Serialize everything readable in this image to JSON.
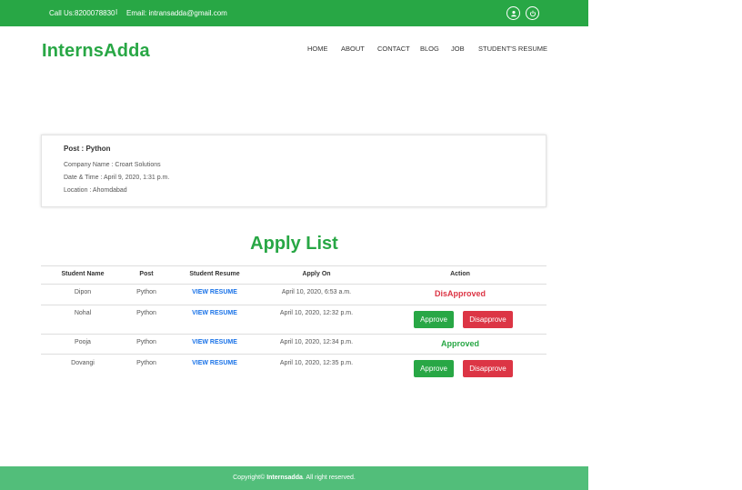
{
  "topbar": {
    "contact": "Call Us:8200078830",
    "separator": "I",
    "email": "Email: intransadda@gmail.com",
    "icons": [
      "user-icon",
      "power-icon"
    ]
  },
  "brand": {
    "name": "InternsAdda"
  },
  "nav": [
    "HOME",
    "ABOUT",
    "CONTACT",
    "BLOG",
    "JOB",
    "STUDENT'S RESUME"
  ],
  "post": {
    "title": "Post : Python",
    "company": "Company Name : Croart Solutions",
    "datetime": "Date & Time : April 9, 2020, 1:31 p.m.",
    "location": "Location : Ahomdabad"
  },
  "apply_list": {
    "title": "Apply List",
    "headers": [
      "Student Name",
      "Post",
      "Student Resume",
      "Apply On",
      "Action"
    ],
    "rows": [
      {
        "name": "Dipon",
        "post": "Python",
        "resume": "VIEW RESUME",
        "applied_on": "April 10, 2020, 6:53 a.m.",
        "status": "DisApproved"
      },
      {
        "name": "Nohal",
        "post": "Python",
        "resume": "VIEW RESUME",
        "applied_on": "April 10, 2020, 12:32 p.m.",
        "approve": "Approve",
        "disapprove": "Disapprove"
      },
      {
        "name": "Pooja",
        "post": "Python",
        "resume": "VIEW RESUME",
        "applied_on": "April 10, 2020, 12:34 p.m.",
        "status": "Approved"
      },
      {
        "name": "Dovangi",
        "post": "Python",
        "resume": "VIEW RESUME",
        "applied_on": "April 10, 2020, 12:35 p.m.",
        "approve": "Approve",
        "disapprove": "Disapprove"
      }
    ]
  },
  "footer": {
    "prefix": "Copyright©",
    "brand": "Internsadda",
    "suffix": ". All right reserved."
  },
  "colors": {
    "primary": "#28a745",
    "danger": "#dc3545",
    "link": "#1a73e8",
    "footer": "#52be7a"
  }
}
